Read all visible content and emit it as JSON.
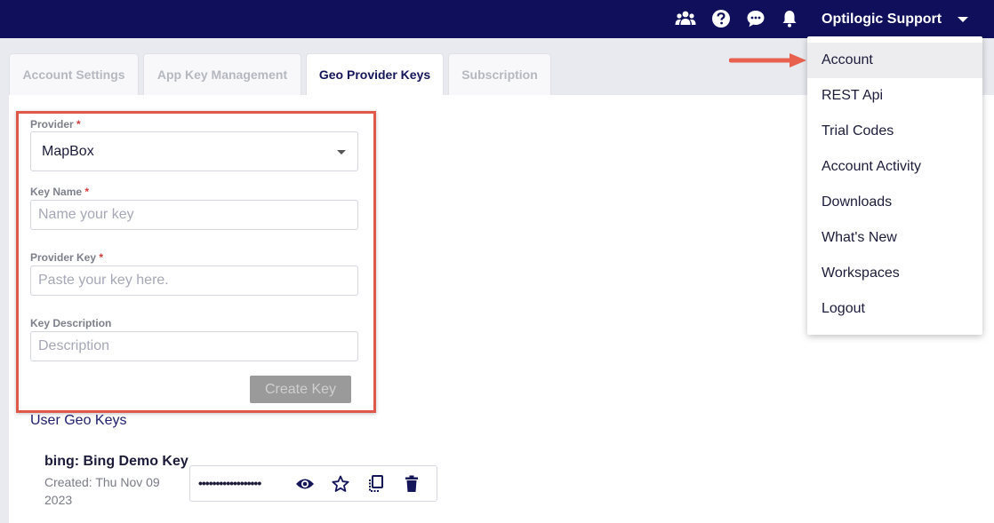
{
  "header": {
    "user_name": "Optilogic Support",
    "icons": [
      "team-icon",
      "help-icon",
      "chat-icon",
      "bell-icon",
      "caret-down-icon"
    ]
  },
  "tabs": [
    {
      "label": "Account Settings",
      "active": false
    },
    {
      "label": "App Key Management",
      "active": false
    },
    {
      "label": "Geo Provider Keys",
      "active": true
    },
    {
      "label": "Subscription",
      "active": false
    }
  ],
  "form": {
    "provider_label": "Provider",
    "provider_value": "MapBox",
    "key_name_label": "Key Name",
    "key_name_placeholder": "Name your key",
    "provider_key_label": "Provider Key",
    "provider_key_placeholder": "Paste your key here.",
    "description_label": "Key Description",
    "description_placeholder": "Description",
    "required_mark": "*",
    "create_button": "Create Key"
  },
  "user_keys": {
    "title": "User Geo Keys",
    "items": [
      {
        "name": "bing: Bing Demo Key",
        "created": "Created: Thu Nov 09 2023",
        "masked_key": "••••••••••••••••••",
        "actions": [
          "eye-icon",
          "star-icon",
          "copy-icon",
          "trash-icon"
        ]
      }
    ]
  },
  "menu": {
    "items": [
      {
        "label": "Account",
        "highlighted": true
      },
      {
        "label": "REST Api",
        "highlighted": false
      },
      {
        "label": "Trial Codes",
        "highlighted": false
      },
      {
        "label": "Account Activity",
        "highlighted": false
      },
      {
        "label": "Downloads",
        "highlighted": false
      },
      {
        "label": "What's New",
        "highlighted": false
      },
      {
        "label": "Workspaces",
        "highlighted": false
      },
      {
        "label": "Logout",
        "highlighted": false
      }
    ]
  },
  "colors": {
    "header_bg": "#0f0f5c",
    "highlight_border": "#e0584a",
    "arrow": "#e8614f",
    "disabled_button": "#9a9a9a"
  }
}
